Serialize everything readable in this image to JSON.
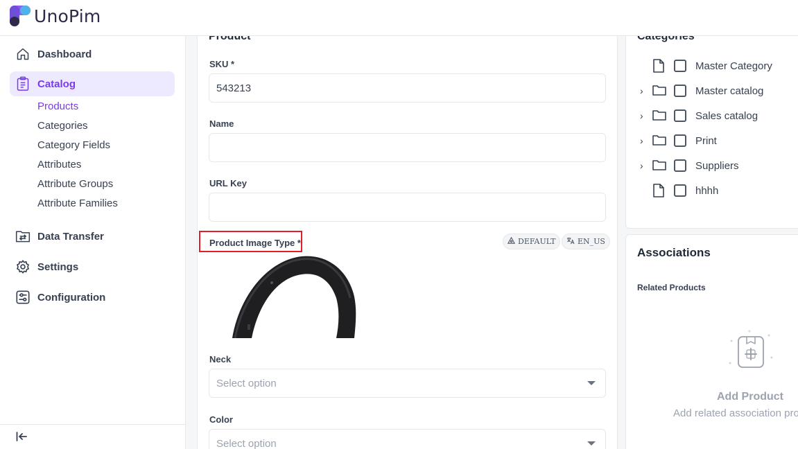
{
  "app": {
    "name": "UnoPim"
  },
  "sidebar": {
    "items": [
      {
        "label": "Dashboard",
        "icon": "home-icon"
      },
      {
        "label": "Catalog",
        "icon": "clipboard-list-icon",
        "active": true
      },
      {
        "label": "Data Transfer",
        "icon": "folder-transfer-icon"
      },
      {
        "label": "Settings",
        "icon": "gear-icon"
      },
      {
        "label": "Configuration",
        "icon": "sliders-icon"
      }
    ],
    "catalog_sub": [
      {
        "label": "Products",
        "active": true
      },
      {
        "label": "Categories"
      },
      {
        "label": "Category Fields"
      },
      {
        "label": "Attributes"
      },
      {
        "label": "Attribute Groups"
      },
      {
        "label": "Attribute Families"
      }
    ],
    "collapse_icon": "collapse-left-icon"
  },
  "product_form": {
    "section_title": "Product",
    "sku": {
      "label": "SKU *",
      "value": "543213"
    },
    "name": {
      "label": "Name",
      "value": ""
    },
    "url_key": {
      "label": "URL Key",
      "value": ""
    },
    "image": {
      "label": "Product Image Type *",
      "channel_chip": "DEFAULT",
      "locale_chip": "EN_US"
    },
    "neck": {
      "label": "Neck",
      "placeholder": "Select option"
    },
    "color": {
      "label": "Color",
      "placeholder": "Select option"
    }
  },
  "categories": {
    "title": "Categories",
    "items": [
      {
        "label": "Master Category",
        "type": "file",
        "expandable": false
      },
      {
        "label": "Master catalog",
        "type": "folder",
        "expandable": true
      },
      {
        "label": "Sales catalog",
        "type": "folder",
        "expandable": true
      },
      {
        "label": "Print",
        "type": "folder",
        "expandable": true
      },
      {
        "label": "Suppliers",
        "type": "folder",
        "expandable": true
      },
      {
        "label": "hhhh",
        "type": "file",
        "expandable": false
      }
    ]
  },
  "associations": {
    "title": "Associations",
    "related_label": "Related Products",
    "empty_title": "Add Product",
    "empty_subtitle": "Add related association products"
  },
  "colors": {
    "accent": "#7c3aed",
    "active_bg": "#ede9fe",
    "highlight": "#e11d27"
  }
}
